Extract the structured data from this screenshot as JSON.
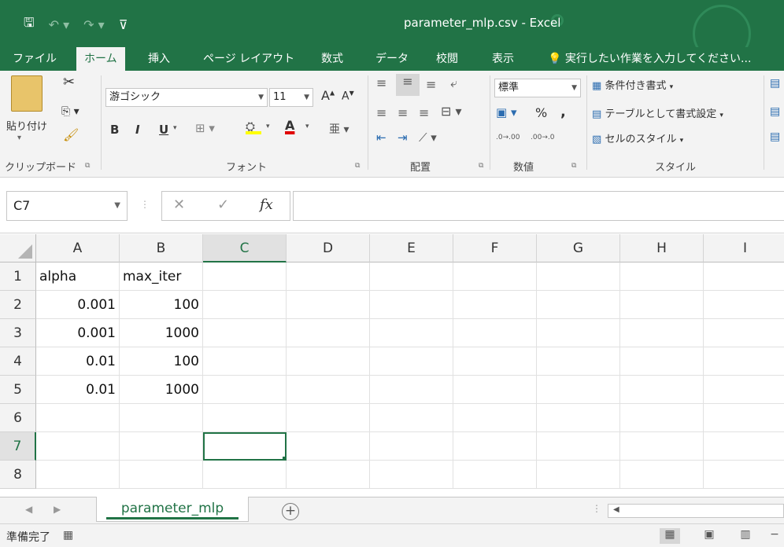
{
  "titlebar": {
    "title": "parameter_mlp.csv - Excel",
    "icons": [
      "save-icon",
      "undo-icon",
      "redo-icon",
      "customize-qat-icon"
    ]
  },
  "tabs": {
    "items": [
      "ファイル",
      "ホーム",
      "挿入",
      "ページ レイアウト",
      "数式",
      "データ",
      "校閲",
      "表示"
    ],
    "active": "ホーム",
    "tell_me": "実行したい作業を入力してください..."
  },
  "ribbon": {
    "clipboard": {
      "paste_label": "貼り付け",
      "group_label": "クリップボード"
    },
    "font": {
      "font_name": "游ゴシック",
      "font_size": "11",
      "grow": "A",
      "shrink": "A",
      "bold": "B",
      "italic": "I",
      "underline": "U",
      "font_color_glyph": "A",
      "group_label": "フォント"
    },
    "alignment": {
      "group_label": "配置"
    },
    "number": {
      "format": "標準",
      "percent": "%",
      "comma": ",",
      "inc_decimal": ".0→.00",
      "dec_decimal": ".00→.0",
      "group_label": "数値"
    },
    "styles": {
      "conditional": "条件付き書式",
      "table": "テーブルとして書式設定",
      "cell_styles": "セルのスタイル",
      "group_label": "スタイル"
    }
  },
  "formula_bar": {
    "name_box": "C7",
    "cancel": "✕",
    "enter": "✓",
    "fx": "fx",
    "value": ""
  },
  "grid": {
    "columns": [
      "A",
      "B",
      "C",
      "D",
      "E",
      "F",
      "G",
      "H",
      "I"
    ],
    "selected_column": "C",
    "rows": [
      "1",
      "2",
      "3",
      "4",
      "5",
      "6",
      "7",
      "8"
    ],
    "selected_row": "7",
    "active_cell": "C7",
    "cells": {
      "A1": "alpha",
      "B1": "max_iter",
      "A2": "0.001",
      "B2": "100",
      "A3": "0.001",
      "B3": "1000",
      "A4": "0.01",
      "B4": "100",
      "A5": "0.01",
      "B5": "1000"
    }
  },
  "sheets": {
    "tabs": [
      "parameter_mlp"
    ],
    "active": "parameter_mlp",
    "add_label": "+"
  },
  "status": {
    "text": "準備完了"
  },
  "colors": {
    "accent": "#217346",
    "ribbon_bg": "#f3f3f3",
    "header_bg": "#f3f3f3",
    "grid_line": "#e1e1e1",
    "underline_yellow": "#ffff00",
    "underline_red": "#e00000"
  }
}
